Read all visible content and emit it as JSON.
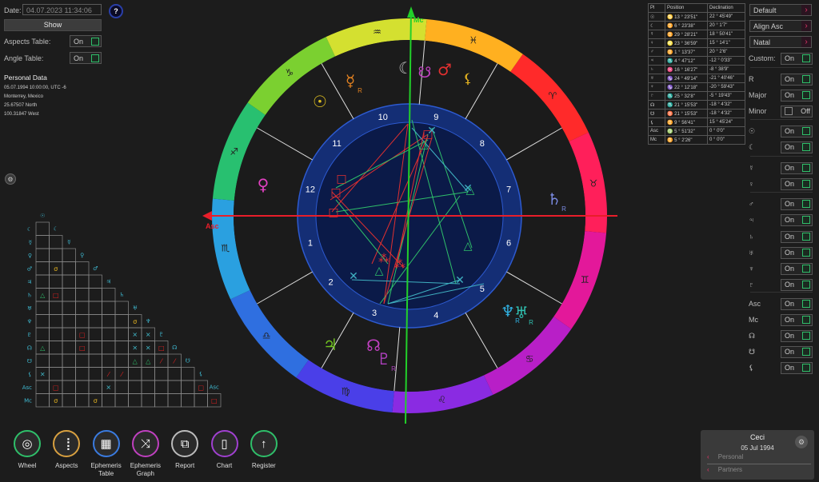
{
  "top": {
    "date_label": "Date:",
    "date_value": "04.07.2023 11:34:06",
    "help_label": "?",
    "show_button": "Show",
    "aspects_table_label": "Aspects Table:",
    "aspects_table_value": "On",
    "angle_table_label": "Angle Table:",
    "angle_table_value": "On"
  },
  "personal": {
    "heading": "Personal Data",
    "line1": "05.07.1994 10:00:00, UTC -6",
    "line2": "Monterrey, Mexico",
    "line3": "25.67507 North",
    "line4": "100.31847 West"
  },
  "aspect_grid": {
    "row_symbols": [
      "☾",
      "☿",
      "♀",
      "♂",
      "♃",
      "♄",
      "♅",
      "♆",
      "♇",
      "☊",
      "☋",
      "⚸",
      "Asc",
      "Mc"
    ],
    "col_symbols": [
      "☉",
      "☾",
      "☿",
      "♀",
      "♂",
      "♃",
      "♄",
      "♅",
      "♆",
      "♇",
      "☊",
      "☋",
      "⚸",
      "Asc"
    ],
    "marks": [
      {
        "r": 3,
        "c": 1,
        "g": "σ",
        "color": "#e0b020"
      },
      {
        "r": 5,
        "c": 0,
        "g": "△",
        "color": "#2fbf6a"
      },
      {
        "r": 5,
        "c": 1,
        "g": "□",
        "color": "#e02020"
      },
      {
        "r": 7,
        "c": 7,
        "g": "σ",
        "color": "#e0b020"
      },
      {
        "r": 8,
        "c": 3,
        "g": "□",
        "color": "#e02020"
      },
      {
        "r": 8,
        "c": 7,
        "g": "✕",
        "color": "#3fb0c0"
      },
      {
        "r": 8,
        "c": 8,
        "g": "✕",
        "color": "#3fb0c0"
      },
      {
        "r": 9,
        "c": 0,
        "g": "△",
        "color": "#2fbf6a"
      },
      {
        "r": 9,
        "c": 3,
        "g": "□",
        "color": "#e02020"
      },
      {
        "r": 9,
        "c": 7,
        "g": "✕",
        "color": "#3fb0c0"
      },
      {
        "r": 9,
        "c": 8,
        "g": "✕",
        "color": "#3fb0c0"
      },
      {
        "r": 9,
        "c": 9,
        "g": "□",
        "color": "#e02020"
      },
      {
        "r": 10,
        "c": 7,
        "g": "△",
        "color": "#2fbf6a"
      },
      {
        "r": 10,
        "c": 8,
        "g": "△",
        "color": "#2fbf6a"
      },
      {
        "r": 10,
        "c": 9,
        "g": "⁄",
        "color": "#e02020"
      },
      {
        "r": 10,
        "c": 10,
        "g": "⁄",
        "color": "#e02020"
      },
      {
        "r": 11,
        "c": 0,
        "g": "✕",
        "color": "#3fb0c0"
      },
      {
        "r": 11,
        "c": 5,
        "g": "⁄",
        "color": "#e02020"
      },
      {
        "r": 11,
        "c": 6,
        "g": "⁄",
        "color": "#e02020"
      },
      {
        "r": 12,
        "c": 1,
        "g": "□",
        "color": "#e02020"
      },
      {
        "r": 12,
        "c": 5,
        "g": "✕",
        "color": "#3fb0c0"
      },
      {
        "r": 12,
        "c": 12,
        "g": "□",
        "color": "#e02020"
      },
      {
        "r": 13,
        "c": 1,
        "g": "σ",
        "color": "#e0b020"
      },
      {
        "r": 13,
        "c": 4,
        "g": "σ",
        "color": "#e0b020"
      },
      {
        "r": 13,
        "c": 13,
        "g": "□",
        "color": "#e02020"
      }
    ]
  },
  "table": {
    "headers": [
      "Pl",
      "Position",
      "Declination"
    ],
    "rows": [
      [
        "☉",
        "♋ 13 ° 23'51\"",
        "22 ° 45'49\""
      ],
      [
        "☾",
        "♊ 6 ° 23'38\"",
        "20 ° 1'7\""
      ],
      [
        "☿",
        "♊ 29 ° 28'21\"",
        "18 ° 50'41\""
      ],
      [
        "♀",
        "♌ 23 ° 36'59\"",
        "15 ° 14'1\""
      ],
      [
        "♂",
        "♊ 1 ° 13'37\"",
        "20 ° 2'6\""
      ],
      [
        "♃",
        "♏ 4 ° 47'12\"",
        "-12 ° 0'33\""
      ],
      [
        "♄",
        "♓ 16 ° 16'27\"",
        "-8 ° 38'9\""
      ],
      [
        "♅",
        "♑ 24 ° 49'14\"",
        "-21 ° 40'46\""
      ],
      [
        "♆",
        "♑ 22 ° 12'18\"",
        "-20 ° 59'43\""
      ],
      [
        "♇",
        "♏ 25 ° 32'8\"",
        "-5 ° 19'43\""
      ],
      [
        "☊",
        "♏ 21 ° 15'53\"",
        "-18 ° 4'32\""
      ],
      [
        "☋",
        "♉ 21 ° 15'53\"",
        "-18 ° 4'32\""
      ],
      [
        "⚸",
        "♊ 9 ° 56'41\"",
        "15 ° 45'24\""
      ],
      [
        "Asc",
        "♍ 5 ° 51'32\"",
        "0 ° 0'0\""
      ],
      [
        "Mc",
        "♊ 5 ° 2'26\"",
        "0 ° 0'0\""
      ]
    ]
  },
  "right_panel": {
    "dropdown1": "Default",
    "dropdown2": "Align Asc",
    "dropdown3": "Natal",
    "rows": [
      {
        "label": "Custom:",
        "value": "On",
        "on": true
      },
      {
        "label": "R",
        "value": "On",
        "on": true
      },
      {
        "label": "Major",
        "value": "On",
        "on": true
      },
      {
        "label": "Minor",
        "value": "Off",
        "on": false
      },
      {
        "label": "☉",
        "value": "On",
        "on": true
      },
      {
        "label": "☾",
        "value": "On",
        "on": true
      },
      {
        "label": "☿",
        "value": "On",
        "on": true
      },
      {
        "label": "♀",
        "value": "On",
        "on": true
      },
      {
        "label": "♂",
        "value": "On",
        "on": true
      },
      {
        "label": "♃",
        "value": "On",
        "on": true
      },
      {
        "label": "♄",
        "value": "On",
        "on": true
      },
      {
        "label": "♅",
        "value": "On",
        "on": true
      },
      {
        "label": "♆",
        "value": "On",
        "on": true
      },
      {
        "label": "♇",
        "value": "On",
        "on": true
      },
      {
        "label": "Asc",
        "value": "On",
        "on": true
      },
      {
        "label": "Mc",
        "value": "On",
        "on": true
      },
      {
        "label": "☊",
        "value": "On",
        "on": true
      },
      {
        "label": "☋",
        "value": "On",
        "on": true
      },
      {
        "label": "⚸",
        "value": "On",
        "on": true
      }
    ]
  },
  "profile": {
    "name": "Ceci",
    "date": "05 Jul 1994",
    "personal": "Personal",
    "partners": "Partners"
  },
  "nav": [
    {
      "label": "Wheel",
      "glyph": "◎",
      "color": "#2fbf6a"
    },
    {
      "label": "Aspects",
      "glyph": "⢸",
      "color": "#d8a040"
    },
    {
      "label": "Ephemeris\nTable",
      "glyph": "▦",
      "color": "#3a7be0"
    },
    {
      "label": "Ephemeris\nGraph",
      "glyph": "⤨",
      "color": "#c040c0"
    },
    {
      "label": "Report",
      "glyph": "⧉",
      "color": "#bbbbbb"
    },
    {
      "label": "Chart",
      "glyph": "▯",
      "color": "#a040d0"
    },
    {
      "label": "Register",
      "glyph": "↑",
      "color": "#2fbf6a"
    }
  ],
  "wheel": {
    "asc_label": "Asc",
    "mc_label": "Mc",
    "houses": [
      "1",
      "2",
      "3",
      "4",
      "5",
      "6",
      "7",
      "8",
      "9",
      "10",
      "11",
      "12"
    ],
    "signs": [
      "♈",
      "♉",
      "♊",
      "♋",
      "♌",
      "♍",
      "♎",
      "♏",
      "♐",
      "♑",
      "♒",
      "♓"
    ],
    "planets": [
      {
        "g": "☉",
        "color": "#e0c020",
        "r": "",
        "name": "sun"
      },
      {
        "g": "☿",
        "color": "#e08020",
        "r": "R",
        "name": "mercury"
      },
      {
        "g": "☾",
        "color": "#bbbbbb",
        "r": "",
        "name": "moon"
      },
      {
        "g": "♂",
        "color": "#e03030",
        "r": "",
        "name": "mars"
      },
      {
        "g": "☋",
        "color": "#c040c0",
        "r": "",
        "name": "south-node"
      },
      {
        "g": "⚸",
        "color": "#e0b020",
        "r": "",
        "name": "lilith"
      },
      {
        "g": "♀",
        "color": "#e040c0",
        "r": "",
        "name": "venus"
      },
      {
        "g": "♄",
        "color": "#7a8ae0",
        "r": "R",
        "name": "saturn"
      },
      {
        "g": "♆",
        "color": "#30b0e0",
        "r": "R",
        "name": "neptune"
      },
      {
        "g": "♅",
        "color": "#30c0b0",
        "r": "R",
        "name": "uranus"
      },
      {
        "g": "♃",
        "color": "#70c020",
        "r": "",
        "name": "jupiter"
      },
      {
        "g": "☊",
        "color": "#c040c0",
        "r": "",
        "name": "north-node"
      },
      {
        "g": "♇",
        "color": "#b040c0",
        "r": "R",
        "name": "pluto"
      }
    ]
  }
}
